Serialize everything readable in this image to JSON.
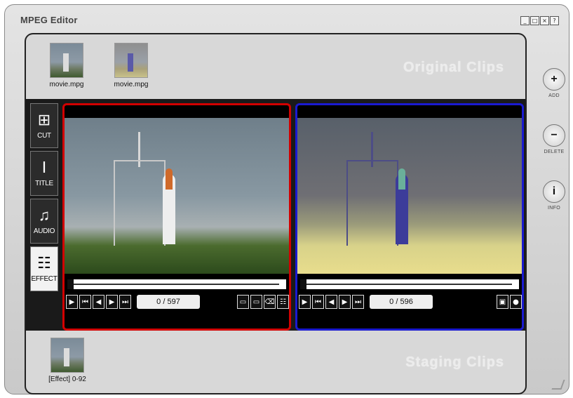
{
  "window": {
    "title": "MPEG Editor",
    "buttons": [
      "_",
      "□",
      "×",
      "?"
    ]
  },
  "original_clips": {
    "label": "Original Clips",
    "items": [
      {
        "name": "movie.mpg"
      },
      {
        "name": "movie.mpg"
      }
    ]
  },
  "staging_clips": {
    "label": "Staging Clips",
    "items": [
      {
        "name": "[Effect] 0-92"
      }
    ]
  },
  "tabs": [
    {
      "label": "CUT",
      "icon": "film-cut-icon",
      "active": false
    },
    {
      "label": "TITLE",
      "icon": "title-icon",
      "active": false
    },
    {
      "label": "AUDIO",
      "icon": "music-disc-icon",
      "active": false
    },
    {
      "label": "EFFECT",
      "icon": "effect-list-icon",
      "active": true
    }
  ],
  "left_viewer": {
    "counter": "0 / 597",
    "border_color": "#d20000",
    "progress": 0
  },
  "right_viewer": {
    "counter": "0 / 596",
    "border_color": "#1a1ad0",
    "progress": 0
  },
  "side_buttons": [
    {
      "symbol": "+",
      "label": "ADD"
    },
    {
      "symbol": "−",
      "label": "DELETE"
    },
    {
      "symbol": "i",
      "label": "INFO"
    }
  ]
}
